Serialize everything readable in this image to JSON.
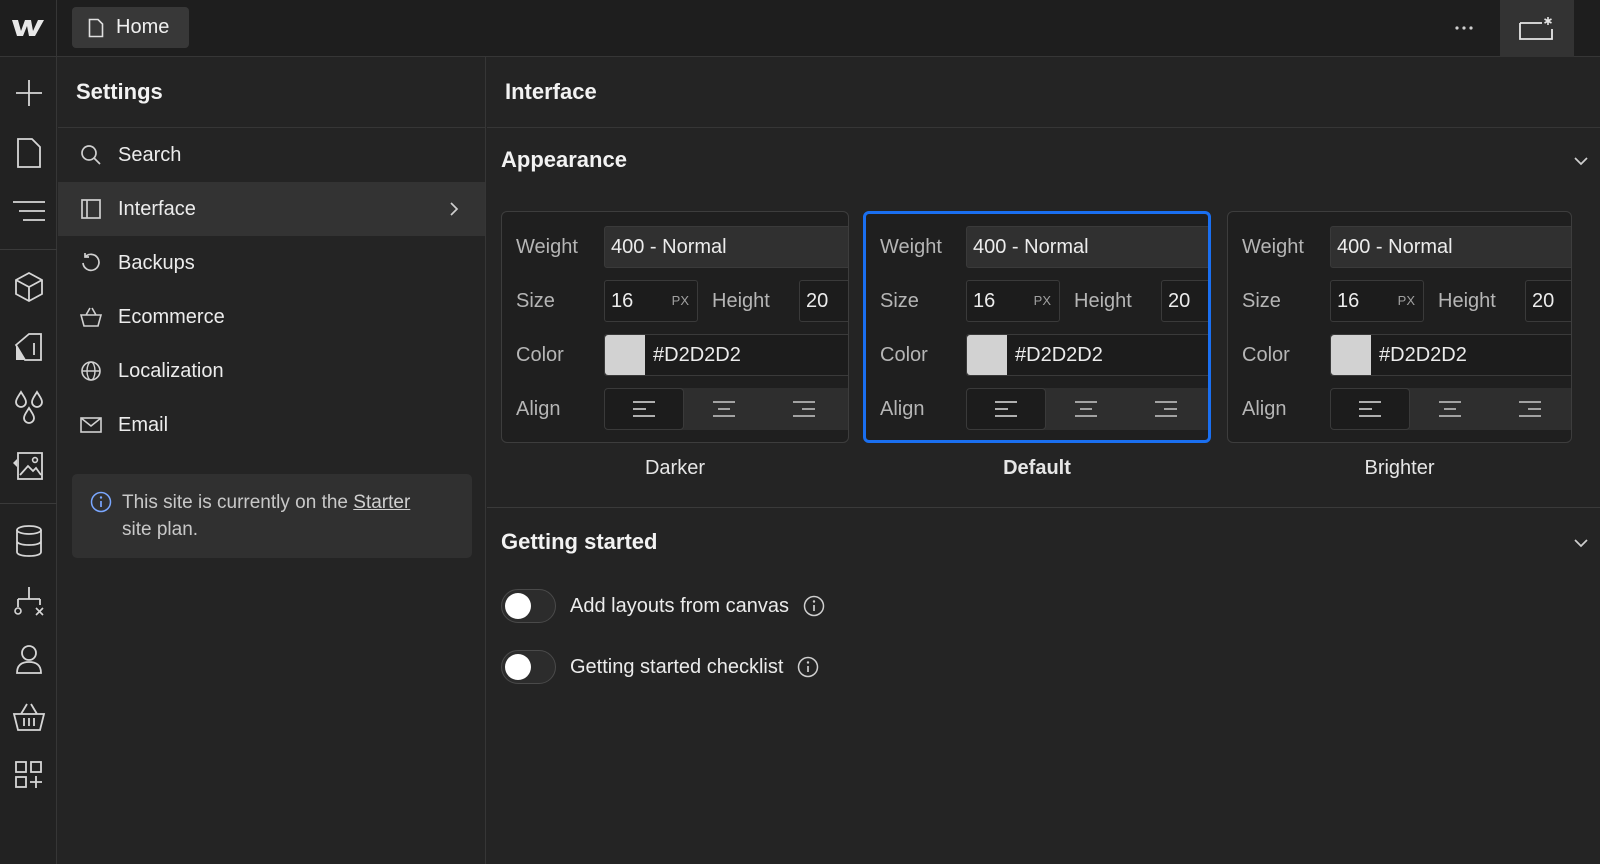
{
  "topbar": {
    "home_label": "Home"
  },
  "settings": {
    "title": "Settings",
    "items": [
      {
        "label": "Search",
        "icon": "search-icon"
      },
      {
        "label": "Interface",
        "icon": "panel-icon",
        "active": true
      },
      {
        "label": "Backups",
        "icon": "restore-icon"
      },
      {
        "label": "Ecommerce",
        "icon": "basket-icon"
      },
      {
        "label": "Localization",
        "icon": "globe-icon"
      },
      {
        "label": "Email",
        "icon": "mail-icon"
      }
    ],
    "plan_note": {
      "before": "This site is currently on the",
      "link": "Starter",
      "after": "site plan."
    }
  },
  "main": {
    "title": "Interface",
    "appearance": {
      "heading": "Appearance",
      "labels": {
        "weight": "Weight",
        "size": "Size",
        "height": "Height",
        "color": "Color",
        "align": "Align",
        "unit": "PX"
      },
      "themes": [
        {
          "name": "Darker",
          "weight": "400 - Normal",
          "size": "16",
          "height": "20",
          "color": "#D2D2D2",
          "selected": false
        },
        {
          "name": "Default",
          "weight": "400 - Normal",
          "size": "16",
          "height": "20",
          "color": "#D2D2D2",
          "selected": true
        },
        {
          "name": "Brighter",
          "weight": "400 - Normal",
          "size": "16",
          "height": "20",
          "color": "#D2D2D2",
          "selected": false
        }
      ]
    },
    "getting_started": {
      "heading": "Getting started",
      "toggles": [
        {
          "label": "Add layouts from canvas",
          "on": false
        },
        {
          "label": "Getting started checklist",
          "on": false
        }
      ]
    }
  },
  "colors": {
    "accent": "#1A6FF0",
    "swatch": "#D2D2D2"
  }
}
